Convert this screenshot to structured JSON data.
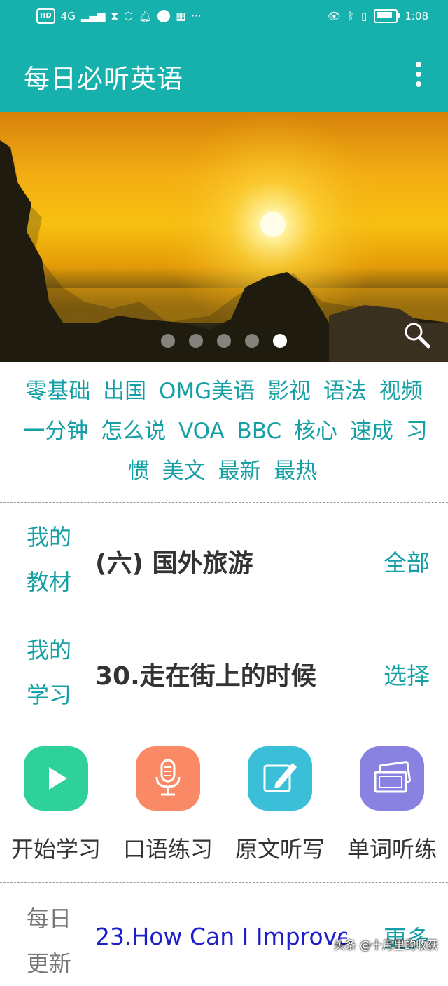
{
  "status_bar": {
    "hd": "HD",
    "net": "4G",
    "time": "1:08"
  },
  "app_bar": {
    "title": "每日必听英语"
  },
  "banner": {
    "slide_count": 5,
    "active_slide": 5
  },
  "tags": [
    "零基础",
    "出国",
    "OMG美语",
    "影视",
    "语法",
    "视频",
    "一分钟",
    "怎么说",
    "VOA",
    "BBC",
    "核心",
    "速成",
    "习惯",
    "美文",
    "最新",
    "最热"
  ],
  "textbook": {
    "label_line1": "我的",
    "label_line2": "教材",
    "value": "(六) 国外旅游",
    "action": "全部"
  },
  "study": {
    "label_line1": "我的",
    "label_line2": "学习",
    "value": "30.走在街上的时候",
    "action": "选择"
  },
  "features": [
    {
      "label": "开始学习",
      "icon": "play-icon",
      "color": "#2ed19a"
    },
    {
      "label": "口语练习",
      "icon": "microphone-icon",
      "color": "#fa8966"
    },
    {
      "label": "原文听写",
      "icon": "edit-note-icon",
      "color": "#3bbfd8"
    },
    {
      "label": "单词听练",
      "icon": "cards-icon",
      "color": "#8a82e0"
    }
  ],
  "daily": {
    "label_line1": "每日",
    "label_line2": "更新",
    "link": "23.How Can I Improve",
    "more": "更多"
  },
  "watermark": "头条 @十月里的收获"
}
